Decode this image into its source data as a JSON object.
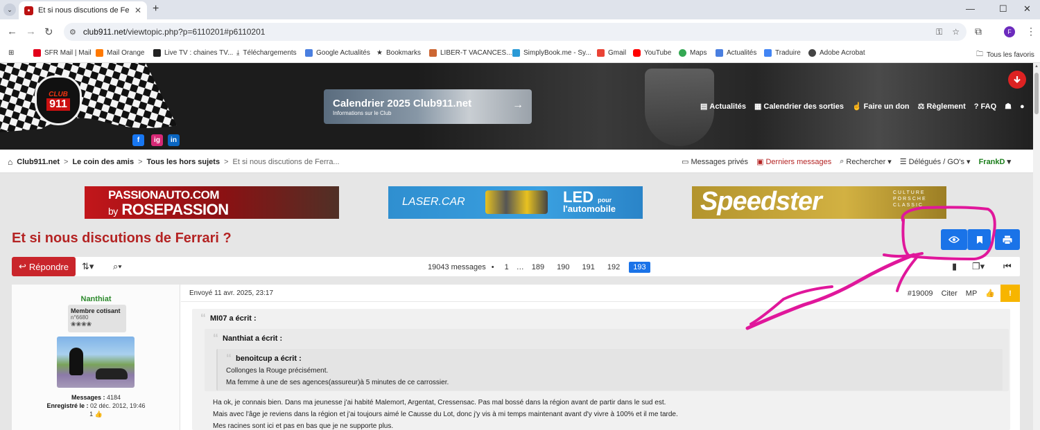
{
  "browser": {
    "tab_title": "Et si nous discutions de Ferrari",
    "url_domain": "club911.net",
    "url_path": "/viewtopic.php?p=6110201#p6110201",
    "profile_initial": "F",
    "bookmarks": [
      "SFR Mail | Mail",
      "Mail Orange",
      "Live TV : chaines TV...",
      "Téléchargements",
      "Google Actualités",
      "Bookmarks",
      "LIBER-T VACANCES...",
      "SimplyBook.me - Sy...",
      "Gmail",
      "YouTube",
      "Maps",
      "Actualités",
      "Traduire",
      "Adobe Acrobat"
    ],
    "all_bookmarks": "Tous les favoris"
  },
  "header": {
    "logo_top": "CLUB",
    "logo_main": "911",
    "banner_title": "Calendrier 2025 Club911.net",
    "banner_subtitle": "Informations sur le Club",
    "nav": [
      "Actualités",
      "Calendrier des sorties",
      "Faire un don",
      "Règlement",
      "FAQ"
    ],
    "social": [
      "f",
      "ig",
      "in"
    ]
  },
  "breadcrumb": {
    "items": [
      "Club911.net",
      "Le coin des amis",
      "Tous les hors sujets"
    ],
    "current": "Et si nous discutions de Ferra..."
  },
  "usernav": {
    "private": "Messages privés",
    "latest": "Derniers messages",
    "search": "Rechercher",
    "delegates": "Délégués / GO's",
    "user": "FrankD"
  },
  "ads": {
    "ad1_line1": "PASSIONAUTO.COM",
    "ad1_by": "by",
    "ad1_line2": "ROSEPASSION",
    "ad2_brand": "LASER.CAR",
    "ad2_led": "LED",
    "ad2_pour": "pour",
    "ad2_auto": "l'automobile",
    "ad3_brand": "Speedster",
    "ad3_tag": "CULTURE PORSCHE CLASSIC"
  },
  "topic": {
    "title": "Et si nous discutions de Ferrari ?",
    "reply": "Répondre",
    "message_count": "19043 messages",
    "pages": [
      "1",
      "…",
      "189",
      "190",
      "191",
      "192"
    ],
    "current_page": "193"
  },
  "post": {
    "author": "Nanthiat",
    "rank": "Membre cotisant",
    "member_no": "n°6680",
    "rank_stars": "❀❀❀❀",
    "messages_label": "Messages :",
    "messages_value": "4184",
    "registered_label": "Enregistré le :",
    "registered_value": "02 déc. 2012, 19:46",
    "likes": "1",
    "sent": "Envoyé 11 avr. 2025, 23:17",
    "number": "#19009",
    "quote_btn": "Citer",
    "pm_btn": "MP",
    "warn": "!",
    "q1_author": "MI07 a écrit :",
    "q2_author": "Nanthiat a écrit :",
    "q3_author": "benoitcup a écrit :",
    "q3_line1": "Collonges la Rouge précisément.",
    "q3_line2": "Ma femme à une de ses agences(assureur)à 5 minutes de ce carrossier.",
    "body_line1": "Ha ok, je connais bien. Dans ma jeunesse j'ai habité Malemort, Argentat, Cressensac. Pas mal bossé dans la région avant de partir dans le sud est.",
    "body_line2": "Mais avec l'âge je reviens dans la région et j'ai toujours aimé le Causse du Lot, donc j'y vis à mi temps maintenant avant d'y vivre à 100% et il me tarde.",
    "body_line3": "Mes racines sont ici et pas en bas que je ne supporte plus."
  },
  "colors": {
    "accent_blue": "#1a73e8",
    "brand_red": "#b42323",
    "annotation": "#e0179b"
  }
}
